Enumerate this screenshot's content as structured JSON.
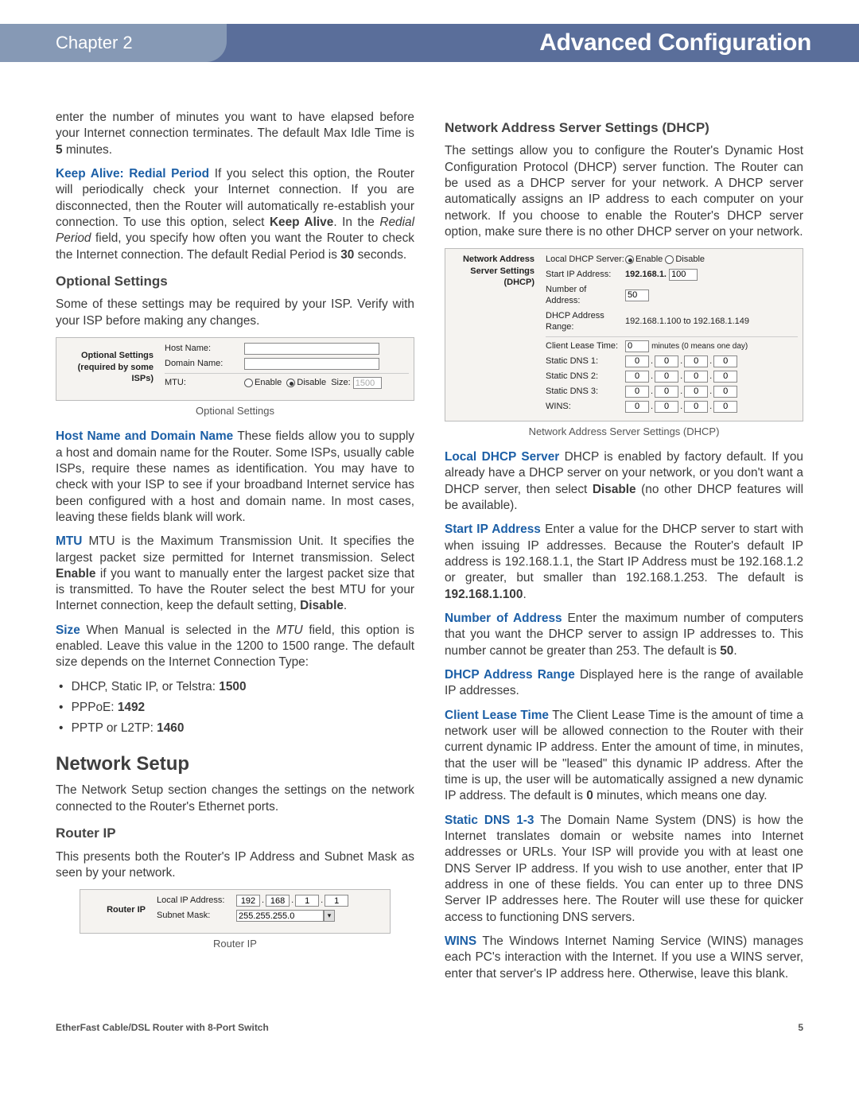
{
  "header": {
    "chapter": "Chapter 2",
    "title": "Advanced Configuration"
  },
  "col1": {
    "p1": "enter the number of minutes you want to have elapsed before your Internet connection terminates. The default Max Idle Time is ",
    "p1b": "5",
    "p1c": " minutes.",
    "keepalive_label": "Keep Alive: Redial Period",
    "keepalive_text": " If you select this option, the Router will periodically check your Internet connection. If you are disconnected, then the Router will automatically re-establish your connection. To use this option, select ",
    "keepalive_b1": "Keep Alive",
    "keepalive_mid": ". In the ",
    "keepalive_i": "Redial Period",
    "keepalive_text2": " field, you specify how often you want the Router to check the Internet connection. The default Redial Period is ",
    "keepalive_b2": "30",
    "keepalive_end": " seconds.",
    "h_optional": "Optional Settings",
    "optional_intro": "Some of these settings may be required by your ISP. Verify with your ISP before making any changes.",
    "fig1": {
      "title_a": "Optional Settings",
      "title_b": "(required by some ISPs)",
      "host": "Host Name:",
      "domain": "Domain Name:",
      "mtu": "MTU:",
      "enable": "Enable",
      "disable": "Disable",
      "size": "Size:",
      "size_val": "1500",
      "caption": "Optional Settings"
    },
    "hostdomain_label": "Host Name and Domain Name",
    "hostdomain_text": "  These fields allow you to supply a host and domain name for the Router. Some ISPs, usually cable ISPs, require these names as identification. You may have to check with your ISP to see if your broadband Internet service has been configured with a host and domain name. In most cases, leaving these fields blank will work.",
    "mtu_label": "MTU",
    "mtu_text": "  MTU is the Maximum Transmission Unit. It specifies the largest packet size permitted for Internet transmission. Select ",
    "mtu_b1": "Enable",
    "mtu_mid": " if you want to manually enter the largest packet size that is transmitted. To have the Router select the best MTU for your Internet connection, keep the default setting, ",
    "mtu_b2": "Disable",
    "mtu_end": ".",
    "size_label": "Size",
    "size_text": "  When Manual is selected in the ",
    "size_i": "MTU",
    "size_text2": " field, this option is enabled. Leave this value in the 1200 to 1500 range. The default size depends on the Internet Connection Type:",
    "li1a": "DHCP, Static IP, or Telstra: ",
    "li1b": "1500",
    "li2a": "PPPoE: ",
    "li2b": "1492",
    "li3a": "PPTP or L2TP: ",
    "li3b": "1460",
    "h_network": "Network Setup",
    "network_intro": "The Network Setup section changes the settings on the network connected to the Router's Ethernet ports.",
    "h_routerip": "Router IP",
    "routerip_text": "This presents both the Router's IP Address and Subnet Mask as seen by your network.",
    "fig2": {
      "title": "Router IP",
      "local_ip": "Local IP Address:",
      "ip1": "192",
      "ip2": "168",
      "ip3": "1",
      "ip4": "1",
      "subnet": "Subnet Mask:",
      "mask": "255.255.255.0",
      "caption": "Router IP"
    }
  },
  "col2": {
    "h_dhcp": "Network Address Server Settings (DHCP)",
    "dhcp_intro": "The settings allow you to configure the Router's Dynamic Host Configuration Protocol (DHCP) server function. The Router can be used as a DHCP server for your network. A DHCP server automatically assigns an IP address to each computer on your network. If you choose to enable the Router's DHCP server option, make sure there is no other DHCP server on your network.",
    "fig3": {
      "title_a": "Network Address",
      "title_b": "Server Settings (DHCP)",
      "local_dhcp": "Local DHCP Server:",
      "enable": "Enable",
      "disable": "Disable",
      "start_ip": "Start IP Address:",
      "start_prefix": "192.168.1.",
      "start_val": "100",
      "num_addr_a": "Number of",
      "num_addr_b": "Address:",
      "num_val": "50",
      "range_a": "DHCP Address",
      "range_b": "Range:",
      "range_val": "192.168.1.100 to 192.168.1.149",
      "lease": "Client Lease Time:",
      "lease_val": "0",
      "lease_unit": "minutes (0 means one day)",
      "dns1": "Static DNS 1:",
      "dns2": "Static DNS 2:",
      "dns3": "Static DNS 3:",
      "wins": "WINS:",
      "caption": "Network Address Server Settings (DHCP)"
    },
    "local_dhcp_label": "Local DHCP Server",
    "local_dhcp_text": "  DHCP is enabled by factory default. If you already have a DHCP server on your network, or you don't want a DHCP server, then select ",
    "local_dhcp_b": "Disable",
    "local_dhcp_end": " (no other DHCP features will be available).",
    "start_ip_label": "Start IP Address",
    "start_ip_text": "  Enter a value for the DHCP server to start with when issuing IP addresses. Because the Router's default IP address is 192.168.1.1, the Start IP Address must be 192.168.1.2 or greater, but smaller than 192.168.1.253. The default is ",
    "start_ip_b": "192.168.1.100",
    "start_ip_end": ".",
    "num_label": "Number of Address",
    "num_text": "  Enter the maximum number of computers that you want the DHCP server to assign IP addresses to. This number cannot be greater than 253. The default is ",
    "num_b": "50",
    "num_end": ".",
    "range_label": "DHCP Address Range",
    "range_text": "  Displayed here is the range of available IP addresses.",
    "lease_label": "Client Lease Time",
    "lease_text": "  The Client Lease Time is the amount of time a network user will be allowed connection to the Router with their current dynamic IP address. Enter the amount of time, in minutes, that the user will be \"leased\" this dynamic IP address. After the time is up, the user will be automatically assigned a new dynamic IP address. The default is ",
    "lease_b": "0",
    "lease_end": " minutes, which means one day.",
    "dns_label": "Static DNS 1-3",
    "dns_text": "  The Domain Name System (DNS) is how the Internet translates domain or website names into Internet addresses or URLs. Your ISP will provide you with at least one DNS Server IP address. If you wish to use another, enter that IP address in one of these fields. You can enter up to three DNS Server IP addresses here. The Router will use these for quicker access to functioning DNS servers.",
    "wins_label": "WINS",
    "wins_text": "  The Windows Internet Naming Service (WINS) manages each PC's interaction with the Internet. If you use a WINS server, enter that server's IP address here. Otherwise, leave this blank."
  },
  "footer": {
    "product": "EtherFast Cable/DSL Router with 8-Port Switch",
    "page": "5"
  }
}
